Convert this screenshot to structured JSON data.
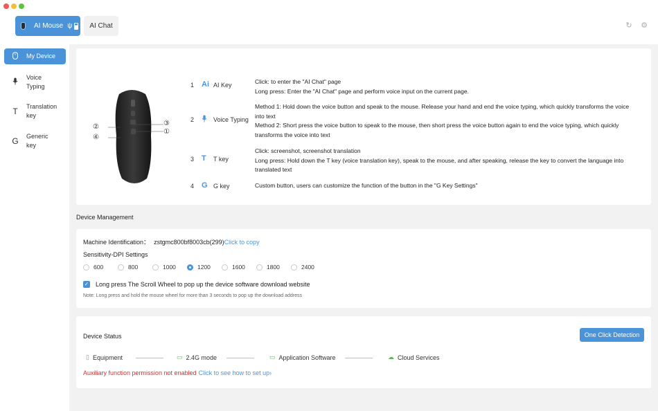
{
  "titlebar": {
    "tabs": [
      {
        "label": "AI Mouse",
        "active": true
      },
      {
        "label": "AI Chat",
        "active": false
      }
    ]
  },
  "sidebar": {
    "items": [
      {
        "label": "My Device",
        "icon": "mouse-icon",
        "active": true
      },
      {
        "label": "Voice\nTyping",
        "icon": "microphone-icon",
        "active": false
      },
      {
        "label": "Translation\nkey",
        "icon": "t-letter-icon",
        "active": false
      },
      {
        "label": "Generic\nkey",
        "icon": "g-letter-icon",
        "active": false
      }
    ]
  },
  "keys": {
    "callouts": [
      "②",
      "③",
      "④",
      "①"
    ],
    "rows": [
      {
        "num": "1",
        "icon": "Ai",
        "name": "AI Key",
        "desc": [
          "Click: to enter the \"AI Chat\" page",
          "Long press: Enter the \"AI Chat\" page and perform voice input on the current page."
        ]
      },
      {
        "num": "2",
        "icon": "🎙",
        "name": "Voice Typing",
        "desc": [
          "Method 1: Hold down the voice button and speak to the mouse. Release your hand and end the voice typing, which quickly transforms the voice into text",
          "Method 2: Short press the voice button to speak to the mouse, then short press the voice button again to end the voice typing, which quickly transforms the voice into text"
        ]
      },
      {
        "num": "3",
        "icon": "T",
        "name": "T key",
        "desc": [
          "Click: screenshot, screenshot translation",
          "Long press: Hold down the T key (voice translation key), speak to the mouse, and after speaking, release the key to convert the language into translated text"
        ]
      },
      {
        "num": "4",
        "icon": "G",
        "name": "G key",
        "desc": [
          "Custom button, users can customize the function of the button in the \"G Key Settings\""
        ]
      }
    ]
  },
  "device_management": {
    "section_title": "Device Management",
    "machine_id_label": "Machine Identification：",
    "machine_id_value": "zstgmc800bf8003cb(299)",
    "copy_label": "Click to copy",
    "dpi_label": "Sensitivity-DPI Settings",
    "dpi_options": [
      "600",
      "800",
      "1000",
      "1200",
      "1600",
      "1800",
      "2400"
    ],
    "dpi_selected": "1200",
    "scroll_option_label": "Long press The Scroll Wheel to pop up the device software download website",
    "scroll_option_checked": true,
    "note": "Note: Long press and hold the mouse wheel for more than 3 seconds to pop up the download address"
  },
  "device_status": {
    "title": "Device Status",
    "detect_button": "One Click Detection",
    "items": [
      {
        "label": "Equipment",
        "icon": "equipment-icon"
      },
      {
        "label": "2.4G mode",
        "icon": "receiver-icon"
      },
      {
        "label": "Application Software",
        "icon": "monitor-icon"
      },
      {
        "label": "Cloud Services",
        "icon": "cloud-icon"
      }
    ],
    "permission_warning": "Auxiliary function permission not enabled",
    "permission_link": "Click to see how to set up›"
  },
  "colors": {
    "accent": "#4b93d8",
    "warning": "#d9322e",
    "status_ok": "#5cb85c"
  }
}
